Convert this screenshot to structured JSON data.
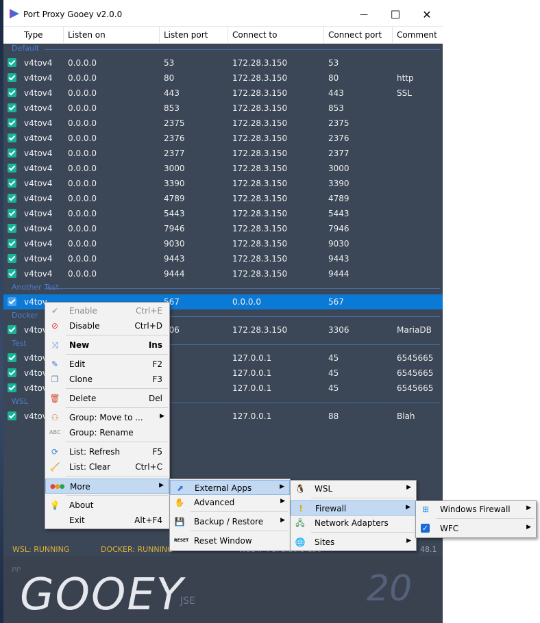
{
  "window": {
    "title": "Port Proxy Gooey  v2.0.0",
    "minimize": "—",
    "maximize": "☐",
    "close": "✕"
  },
  "columns": [
    "Type",
    "Listen on",
    "Listen port",
    "Connect to",
    "Connect port",
    "Comment"
  ],
  "groups": [
    {
      "name": "Default",
      "rows": [
        [
          "v4tov4",
          "0.0.0.0",
          "53",
          "172.28.3.150",
          "53",
          ""
        ],
        [
          "v4tov4",
          "0.0.0.0",
          "80",
          "172.28.3.150",
          "80",
          "http"
        ],
        [
          "v4tov4",
          "0.0.0.0",
          "443",
          "172.28.3.150",
          "443",
          "SSL"
        ],
        [
          "v4tov4",
          "0.0.0.0",
          "853",
          "172.28.3.150",
          "853",
          ""
        ],
        [
          "v4tov4",
          "0.0.0.0",
          "2375",
          "172.28.3.150",
          "2375",
          ""
        ],
        [
          "v4tov4",
          "0.0.0.0",
          "2376",
          "172.28.3.150",
          "2376",
          ""
        ],
        [
          "v4tov4",
          "0.0.0.0",
          "2377",
          "172.28.3.150",
          "2377",
          ""
        ],
        [
          "v4tov4",
          "0.0.0.0",
          "3000",
          "172.28.3.150",
          "3000",
          ""
        ],
        [
          "v4tov4",
          "0.0.0.0",
          "3390",
          "172.28.3.150",
          "3390",
          ""
        ],
        [
          "v4tov4",
          "0.0.0.0",
          "4789",
          "172.28.3.150",
          "4789",
          ""
        ],
        [
          "v4tov4",
          "0.0.0.0",
          "5443",
          "172.28.3.150",
          "5443",
          ""
        ],
        [
          "v4tov4",
          "0.0.0.0",
          "7946",
          "172.28.3.150",
          "7946",
          ""
        ],
        [
          "v4tov4",
          "0.0.0.0",
          "9030",
          "172.28.3.150",
          "9030",
          ""
        ],
        [
          "v4tov4",
          "0.0.0.0",
          "9443",
          "172.28.3.150",
          "9443",
          ""
        ],
        [
          "v4tov4",
          "0.0.0.0",
          "9444",
          "172.28.3.150",
          "9444",
          ""
        ]
      ]
    },
    {
      "name": "Another Test",
      "rows": [
        [
          "v4tov",
          "",
          "567",
          "0.0.0.0",
          "567",
          ""
        ]
      ]
    },
    {
      "name": "Docker",
      "rows": [
        [
          "v4tov",
          "",
          "306",
          "172.28.3.150",
          "3306",
          "MariaDB"
        ]
      ]
    },
    {
      "name": "Test",
      "rows": [
        [
          "v4tov",
          "",
          "5",
          "127.0.0.1",
          "45",
          "6545665"
        ],
        [
          "v4tov",
          "",
          "5",
          "127.0.0.1",
          "45",
          "6545665"
        ],
        [
          "v4tov",
          "",
          "3",
          "127.0.0.1",
          "45",
          "6545665"
        ]
      ]
    },
    {
      "name": "WSL",
      "rows": [
        [
          "v4tov",
          "",
          "3",
          "127.0.0.1",
          "88",
          "Blah"
        ]
      ]
    }
  ],
  "status": {
    "wsl": "WSL: RUNNING",
    "docker": "DOCKER: RUNNING",
    "wsl_ip": "WSL IP : 172.28.3.150",
    "right": "48.1"
  },
  "banner": {
    "pp": "PP",
    "name": "GOOEY",
    "edition": "JSE",
    "version": "20"
  },
  "context_menu": {
    "enable": {
      "label": "Enable",
      "shortcut": "Ctrl+E"
    },
    "disable": {
      "label": "Disable",
      "shortcut": "Ctrl+D"
    },
    "new": {
      "label": "New",
      "shortcut": "Ins"
    },
    "edit": {
      "label": "Edit",
      "shortcut": "F2"
    },
    "clone": {
      "label": "Clone",
      "shortcut": "F3"
    },
    "delete": {
      "label": "Delete",
      "shortcut": "Del"
    },
    "group_move": {
      "label": "Group: Move to ..."
    },
    "group_rename": {
      "label": "Group: Rename"
    },
    "list_refresh": {
      "label": "List: Refresh",
      "shortcut": "F5"
    },
    "list_clear": {
      "label": "List: Clear",
      "shortcut": "Ctrl+C"
    },
    "more": {
      "label": "More"
    },
    "about": {
      "label": "About"
    },
    "exit": {
      "label": "Exit",
      "shortcut": "Alt+F4"
    }
  },
  "more_menu": {
    "external_apps": "External Apps",
    "advanced": "Advanced",
    "backup_restore": "Backup / Restore",
    "reset_window": "Reset Window"
  },
  "external_menu": {
    "wsl": "WSL",
    "firewall": "Firewall",
    "network_adapters": "Network Adapters",
    "sites": "Sites"
  },
  "firewall_menu": {
    "windows_firewall": "Windows Firewall",
    "wfc": "WFC"
  },
  "colors": {
    "accent": "#0b79d6",
    "check": "#16b39a",
    "group": "#4a7fd8",
    "status": "#e0b238"
  }
}
